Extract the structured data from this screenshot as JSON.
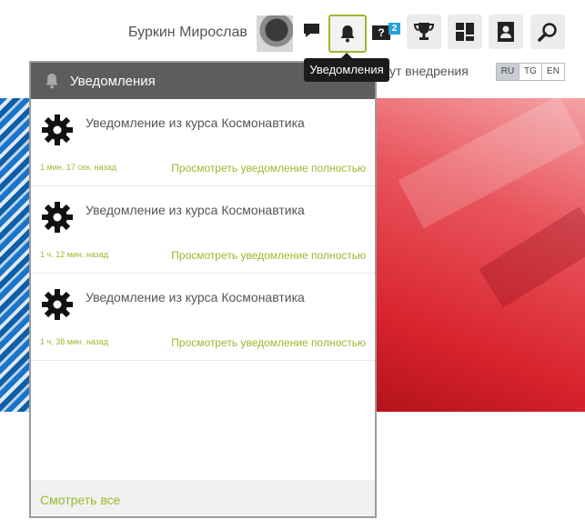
{
  "header": {
    "user_name": "Буркин Мирослав",
    "notification_badge": "2",
    "question_icon_text": "?",
    "tooltip": "Уведомления",
    "background_link": "ут внедрения",
    "languages": [
      "RU",
      "TG",
      "EN"
    ],
    "active_language": "RU"
  },
  "notifications": {
    "title": "Уведомления",
    "items": [
      {
        "message": "Уведомление из курса Космонавтика",
        "time": "1 мин. 17 сек. назад",
        "link": "Просмотреть уведомление полностью"
      },
      {
        "message": "Уведомление из курса Космонавтика",
        "time": "1 ч. 12 мин. назад",
        "link": "Просмотреть уведомление полностью"
      },
      {
        "message": "Уведомление из курса Космонавтика",
        "time": "1 ч. 38 мин. назад",
        "link": "Просмотреть уведомление полностью"
      }
    ],
    "see_all": "Смотреть все"
  },
  "colors": {
    "accent": "#9ab92e",
    "panel_header": "#5d5d5d",
    "badge": "#2aa0d8"
  }
}
